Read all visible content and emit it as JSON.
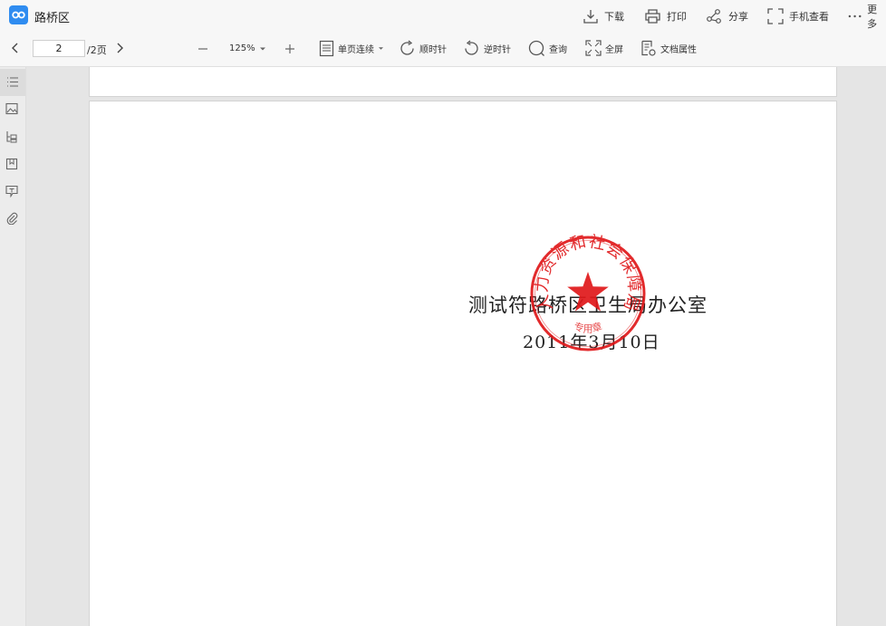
{
  "window": {
    "title": "路桥区"
  },
  "top_actions": {
    "download": "下载",
    "print": "打印",
    "share": "分享",
    "mobile_view": "手机查看",
    "more": "更多"
  },
  "toolbar": {
    "current_page": "2",
    "total_pages": "/2页",
    "zoom": "125%",
    "view_mode": "单页连续",
    "rotate_cw": "顺时针",
    "rotate_ccw": "逆时针",
    "search": "查询",
    "fullscreen": "全屏",
    "doc_properties": "文档属性"
  },
  "sidebar": {
    "items": [
      {
        "icon": "outline-list-icon"
      },
      {
        "icon": "thumbnail-image-icon"
      },
      {
        "icon": "structure-tree-icon"
      },
      {
        "icon": "bookmark-icon"
      },
      {
        "icon": "comment-icon"
      },
      {
        "icon": "attachment-icon"
      }
    ]
  },
  "document": {
    "organization": "测试符路桥区卫生局办公室",
    "date": "2011年3月10日",
    "seal": {
      "text_ring": "人力资源和社会保障局",
      "text_bottom": "专用章",
      "color": "#e0191b"
    }
  },
  "colors": {
    "brand": "#2f8cf0",
    "seal_red": "#e0191b"
  }
}
